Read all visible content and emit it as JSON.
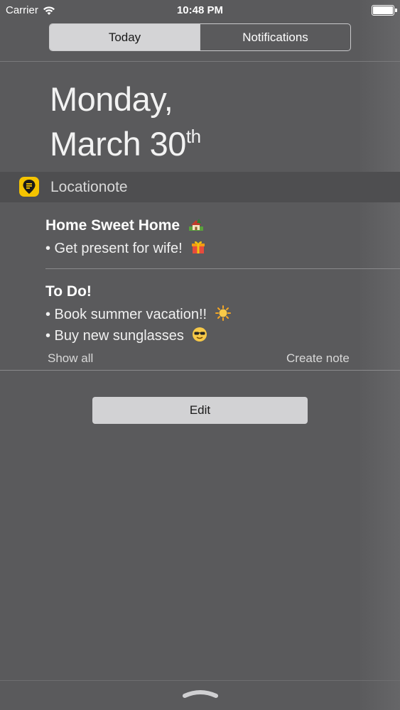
{
  "status_bar": {
    "carrier": "Carrier",
    "time": "10:48 PM",
    "wifi_icon": "wifi-icon",
    "battery_icon": "battery-icon"
  },
  "tabs": {
    "today": "Today",
    "notifications": "Notifications",
    "selected": "Today"
  },
  "date": {
    "line1": "Monday,",
    "line2": "March 30",
    "suffix": "th"
  },
  "widget": {
    "app_name": "Locationote",
    "app_icon": "location-pin-icon",
    "accent_color": "#f5c400",
    "notes": [
      {
        "title": "Home Sweet Home",
        "title_icon": "house-icon",
        "items": [
          {
            "text": "• Get present for wife!",
            "icon": "gift-icon"
          }
        ]
      },
      {
        "title": "To Do!",
        "items": [
          {
            "text": "• Book summer vacation!!",
            "icon": "sun-icon"
          },
          {
            "text": "• Buy new sunglasses",
            "icon": "sunglasses-face-icon"
          }
        ]
      }
    ],
    "show_all": "Show all",
    "create_note": "Create note"
  },
  "edit_button": "Edit",
  "grabber_icon": "grabber-icon"
}
